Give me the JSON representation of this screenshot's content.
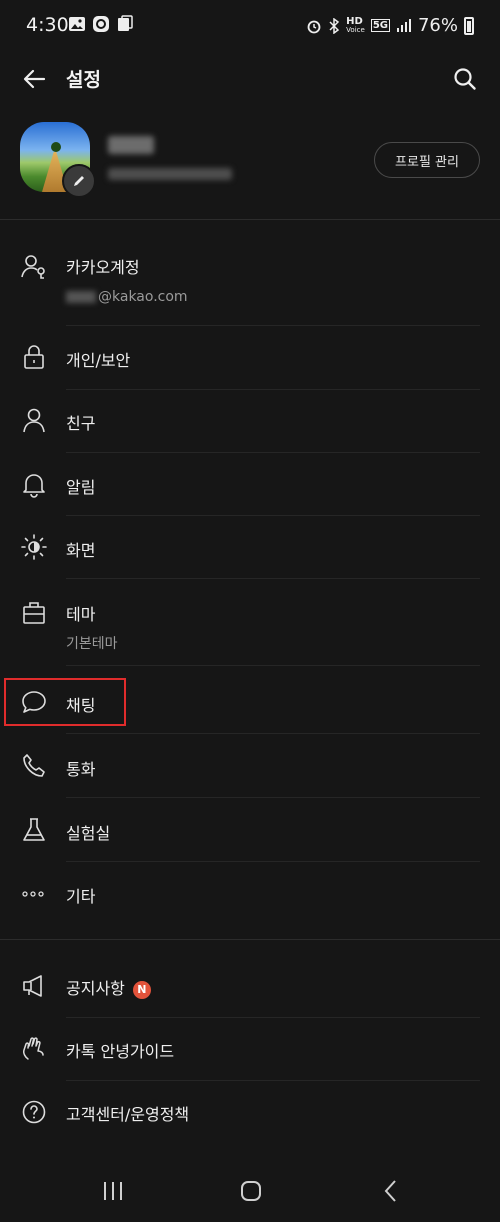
{
  "status_bar": {
    "time": "4:30",
    "battery": "76%",
    "hd_label": "HD",
    "voice_label": "Voice",
    "network": "5G"
  },
  "header": {
    "title": "설정"
  },
  "profile": {
    "manage_label": "프로필 관리"
  },
  "menu": [
    {
      "id": "kakao-account",
      "label": "카카오계정",
      "sub": "@kakao.com",
      "icon": "person-key-icon"
    },
    {
      "id": "privacy",
      "label": "개인/보안",
      "icon": "lock-icon"
    },
    {
      "id": "friends",
      "label": "친구",
      "icon": "person-icon"
    },
    {
      "id": "notifications",
      "label": "알림",
      "icon": "bell-icon"
    },
    {
      "id": "display",
      "label": "화면",
      "icon": "brightness-icon"
    },
    {
      "id": "theme",
      "label": "테마",
      "sub": "기본테마",
      "icon": "paintbrush-icon"
    },
    {
      "id": "chatting",
      "label": "채팅",
      "icon": "chat-bubble-icon"
    },
    {
      "id": "call",
      "label": "통화",
      "icon": "phone-icon"
    },
    {
      "id": "labs",
      "label": "실험실",
      "icon": "flask-icon"
    },
    {
      "id": "etc",
      "label": "기타",
      "icon": "more-dots-icon"
    }
  ],
  "support": [
    {
      "id": "notice",
      "label": "공지사항",
      "badge": "N",
      "icon": "megaphone-icon"
    },
    {
      "id": "guide",
      "label": "카톡 안녕가이드",
      "icon": "waving-hand-icon"
    },
    {
      "id": "help",
      "label": "고객센터/운영정책",
      "icon": "question-circle-icon"
    }
  ]
}
